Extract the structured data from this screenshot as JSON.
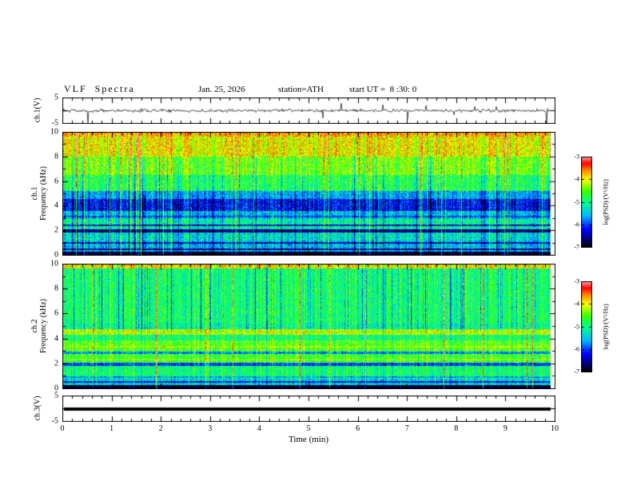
{
  "header": {
    "title": "VLF  Spectra",
    "date": "Jan. 25, 2026",
    "station": "station=ATH",
    "start_ut": "start UT =  8 :30: 0"
  },
  "axes": {
    "time": {
      "label": "Time (min)",
      "ticks": [
        0,
        1,
        2,
        3,
        4,
        5,
        6,
        7,
        8,
        9,
        10
      ],
      "range": [
        0,
        10
      ]
    },
    "freq_ticks": [
      0,
      2,
      4,
      6,
      8,
      10
    ],
    "volt_ticks": [
      5,
      -5
    ],
    "ch1_wave_label": "ch.1(V)",
    "ch1_spec_label_line1": "ch.1",
    "ch1_spec_label_line2": "Frequency (kHz)",
    "ch2_spec_label_line1": "ch.2",
    "ch2_spec_label_line2": "Frequency (kHz)",
    "ch3_label": "ch.3(V)"
  },
  "colorbar": {
    "label": "log(PSD)/(V²/Hz)",
    "ticks": [
      -3,
      -4,
      -5,
      -6,
      -7
    ],
    "range": [
      -7,
      -3
    ]
  },
  "colors": {
    "background": "#ffffff",
    "frame": "#000000",
    "trace": "#000000",
    "cmap_stops": "black-blue-cyan-green-yellow-orange-red-pink"
  },
  "chart_data": [
    {
      "type": "line",
      "panel": "ch1-waveform",
      "ylabel": "ch.1(V)",
      "xlim": [
        0,
        10
      ],
      "ylim": [
        -5,
        5
      ],
      "yticks": [
        5,
        -5
      ],
      "description": "Broadband noisy voltage trace centered on 0 V with dense impulsive spikes up to about ±5 V",
      "noise_std_v": 0.35,
      "spike_prob": 0.022,
      "spike_max_v": 4.8
    },
    {
      "type": "heatmap",
      "panel": "ch1-spectrogram",
      "ylabel": "Frequency (kHz)",
      "xlim": [
        0,
        10
      ],
      "ylim": [
        0,
        10
      ],
      "yticks": [
        0,
        2,
        4,
        6,
        8,
        10
      ],
      "zlabel": "log(PSD)/(V²/Hz)",
      "zlim": [
        -7,
        -3
      ],
      "bands": [
        [
          0,
          0.35,
          -6.9
        ],
        [
          0.35,
          1.2,
          -5.5
        ],
        [
          1.2,
          2.2,
          -5.3
        ],
        [
          2.2,
          3,
          -5.1
        ],
        [
          3,
          3.6,
          -5.5
        ],
        [
          3.6,
          4.6,
          -6.2
        ],
        [
          4.6,
          5.2,
          -5.6
        ],
        [
          5.2,
          6.5,
          -4.8
        ],
        [
          6.5,
          8,
          -4.4
        ],
        [
          8,
          9.6,
          -4.0
        ],
        [
          9.6,
          10,
          -3.7
        ]
      ],
      "lines": [
        [
          2.05,
          -6.6,
          2
        ],
        [
          2.5,
          -6.3,
          1
        ],
        [
          1.05,
          -6.4,
          1
        ],
        [
          3.2,
          -6.0,
          1
        ],
        [
          0.55,
          -6.5,
          1
        ]
      ],
      "streaks": {
        "bright_prob": 0.045,
        "bright_amp": 1.3,
        "dark_prob": 0.1,
        "dark_amp": 0.9,
        "dark_min_f": 0,
        "dark_max_f": 8,
        "jitter": 0.35
      },
      "noise": 0.5
    },
    {
      "type": "heatmap",
      "panel": "ch2-spectrogram",
      "ylabel": "Frequency (kHz)",
      "xlim": [
        0,
        10
      ],
      "ylim": [
        0,
        10
      ],
      "yticks": [
        0,
        2,
        4,
        6,
        8,
        10
      ],
      "zlabel": "log(PSD)/(V²/Hz)",
      "zlim": [
        -7,
        -3
      ],
      "bands": [
        [
          0,
          0.35,
          -6.9
        ],
        [
          0.35,
          0.8,
          -5.4
        ],
        [
          0.8,
          1.85,
          -4.9
        ],
        [
          1.85,
          2.1,
          -6.0
        ],
        [
          2.1,
          2.8,
          -4.6
        ],
        [
          2.8,
          3,
          -5.7
        ],
        [
          3,
          3.9,
          -4.5
        ],
        [
          3.9,
          4.35,
          -4.9
        ],
        [
          4.35,
          4.75,
          -4.15
        ],
        [
          4.75,
          5.2,
          -5.0
        ],
        [
          5.2,
          9.6,
          -4.85
        ],
        [
          9.6,
          10,
          -3.9
        ]
      ],
      "lines": [
        [
          1.0,
          -5.6,
          1
        ],
        [
          3.4,
          -4.2,
          1
        ],
        [
          2.4,
          -4.3,
          1
        ],
        [
          0.6,
          -6.2,
          1
        ]
      ],
      "streaks": {
        "bright_prob": 0.018,
        "bright_amp": 1.6,
        "dark_prob": 0.13,
        "dark_amp": 1.1,
        "dark_min_f": 4.5,
        "dark_max_f": 10,
        "jitter": 0.3
      },
      "noise": 0.45
    },
    {
      "type": "line",
      "panel": "ch3-waveform",
      "ylabel": "ch.3(V)",
      "xlim": [
        0,
        10
      ],
      "ylim": [
        -5,
        5
      ],
      "yticks": [
        5,
        -5
      ],
      "description": "Constant flat thick line at 0 V (channel flat)",
      "value": 0
    }
  ]
}
